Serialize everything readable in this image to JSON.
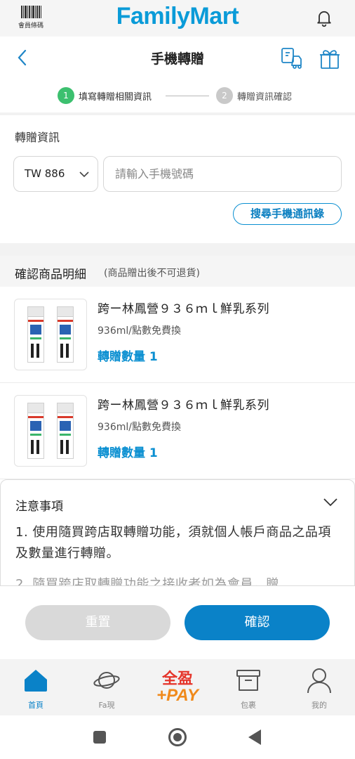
{
  "topbar": {
    "barcode_label": "會員條碼",
    "brand": "FamilyMart"
  },
  "header": {
    "title": "手機轉贈"
  },
  "steps": [
    {
      "num": "1",
      "label": "填寫轉贈相關資訊"
    },
    {
      "num": "2",
      "label": "轉贈資訊確認"
    }
  ],
  "transfer": {
    "section_label": "轉贈資訊",
    "country_code": "TW 886",
    "phone_placeholder": "請輸入手機號碼",
    "contacts_button": "搜尋手機通訊錄"
  },
  "products": {
    "section_label": "確認商品明細",
    "note": "(商品贈出後不可退貨)",
    "items": [
      {
        "name": "跨ー林鳳營９３６ｍｌ鮮乳系列",
        "desc": "936ml/點數免費換",
        "qty": "轉贈數量 1"
      },
      {
        "name": "跨ー林鳳營９３６ｍｌ鮮乳系列",
        "desc": "936ml/點數免費換",
        "qty": "轉贈數量 1"
      }
    ]
  },
  "notice": {
    "title": "注意事項",
    "item1": "1. 使用隨買跨店取轉贈功能，須就個人帳戶商品之品項及數量進行轉贈。",
    "item2_partial": "2. 隨買跨店取轉贈功能之接收者如為會員，贈"
  },
  "buttons": {
    "reset": "重置",
    "confirm": "確認"
  },
  "tabbar": {
    "home": "首頁",
    "fa": "Fa現",
    "pay_top": "全盈",
    "pay_bottom": "+PAY",
    "package": "包裹",
    "mine": "我的"
  },
  "colors": {
    "brand": "#0a9bd8",
    "accent": "#0a82c8",
    "step_active": "#3cc06f"
  }
}
